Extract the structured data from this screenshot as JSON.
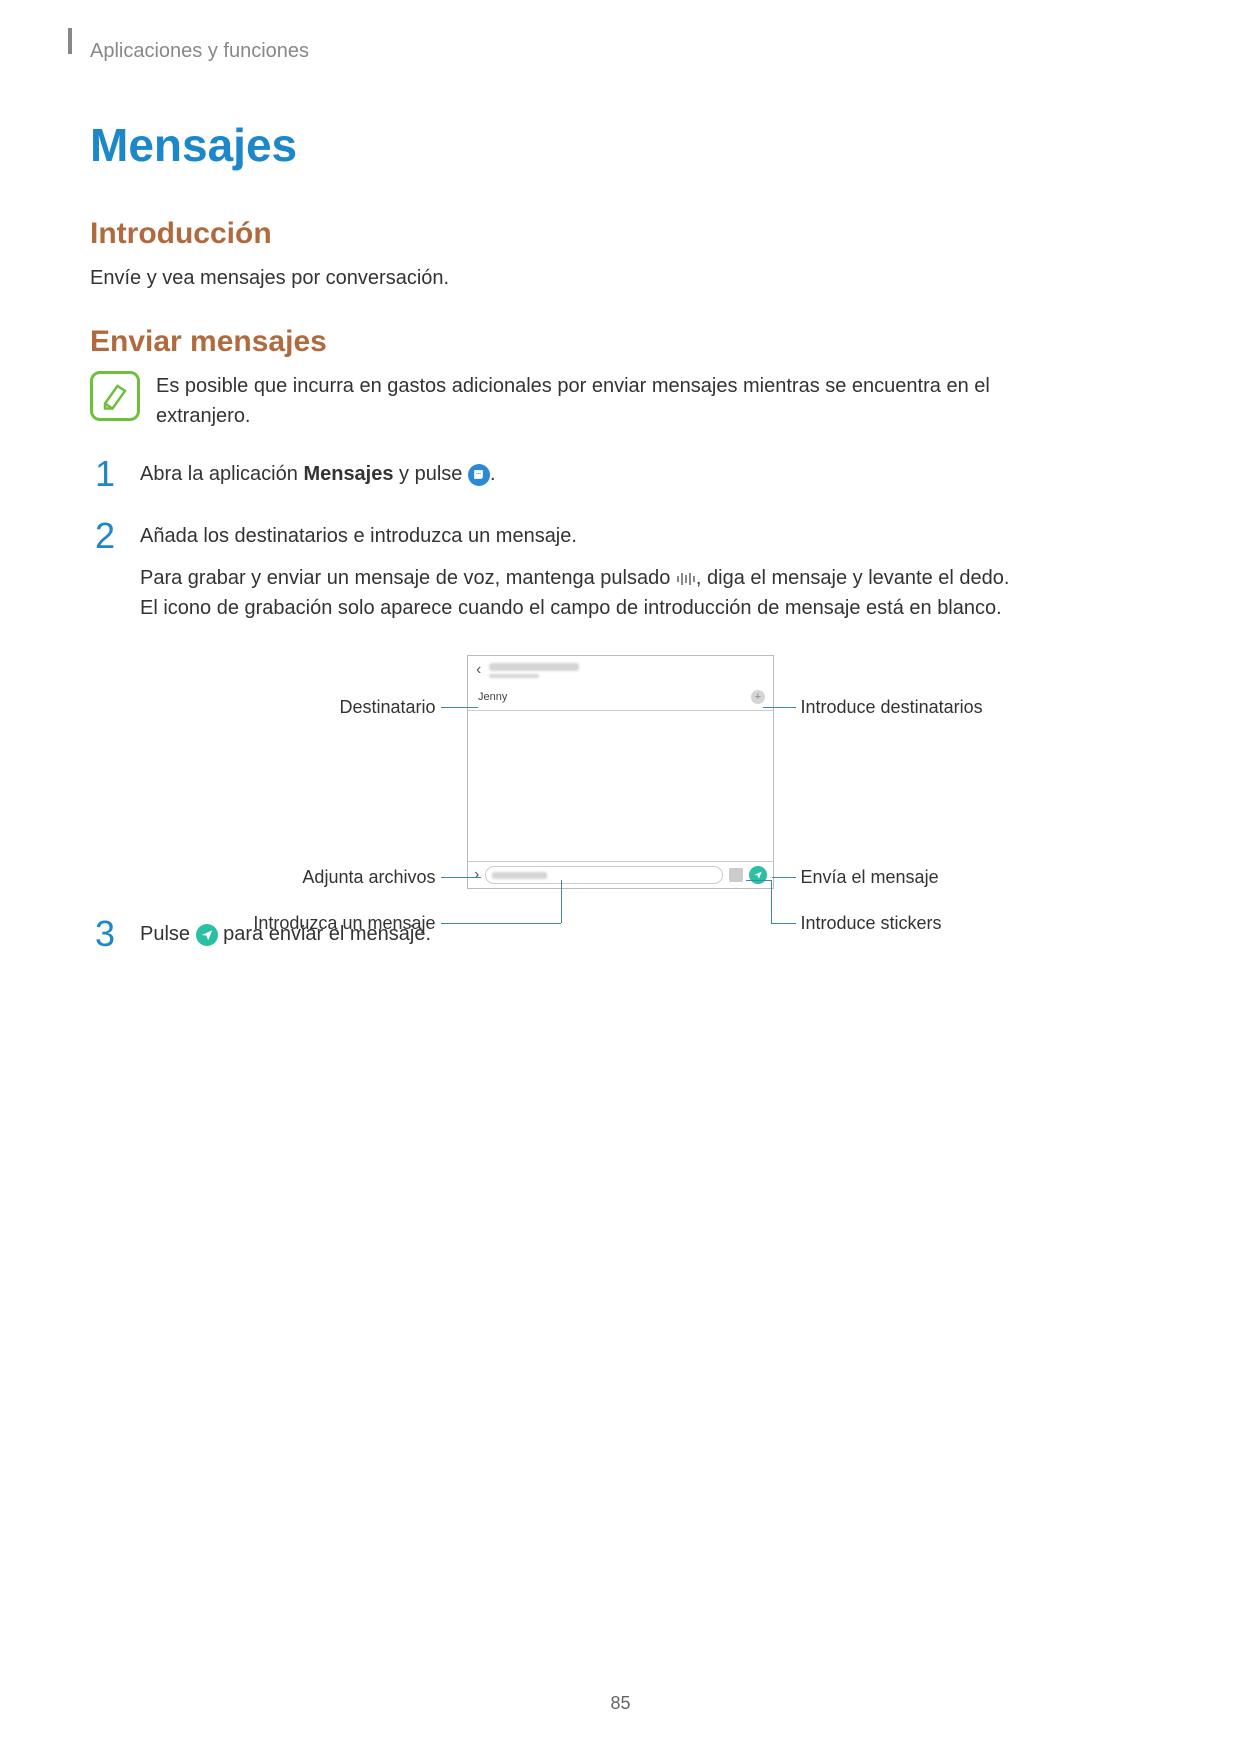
{
  "breadcrumb": "Aplicaciones y funciones",
  "title": "Mensajes",
  "section_intro_heading": "Introducción",
  "intro_text": "Envíe y vea mensajes por conversación.",
  "section_send_heading": "Enviar mensajes",
  "note_text": "Es posible que incurra en gastos adicionales por enviar mensajes mientras se encuentra en el extranjero.",
  "steps": {
    "s1": {
      "num": "1",
      "pre": "Abra la aplicación ",
      "bold": "Mensajes",
      "post": " y pulse ",
      "tail": "."
    },
    "s2": {
      "num": "2",
      "line1": "Añada los destinatarios e introduzca un mensaje.",
      "line2_pre": "Para grabar y enviar un mensaje de voz, mantenga pulsado ",
      "line2_post": ", diga el mensaje y levante el dedo. El icono de grabación solo aparece cuando el campo de introducción de mensaje está en blanco."
    },
    "s3": {
      "num": "3",
      "pre": "Pulse ",
      "post": " para enviar el mensaje."
    }
  },
  "figure": {
    "recipient_name": "Jenny",
    "labels": {
      "recipient": "Destinatario",
      "add_recipients": "Introduce destinatarios",
      "attach": "Adjunta archivos",
      "send": "Envía el mensaje",
      "enter_msg": "Introduzca un mensaje",
      "stickers": "Introduce stickers"
    }
  },
  "page_number": "85"
}
